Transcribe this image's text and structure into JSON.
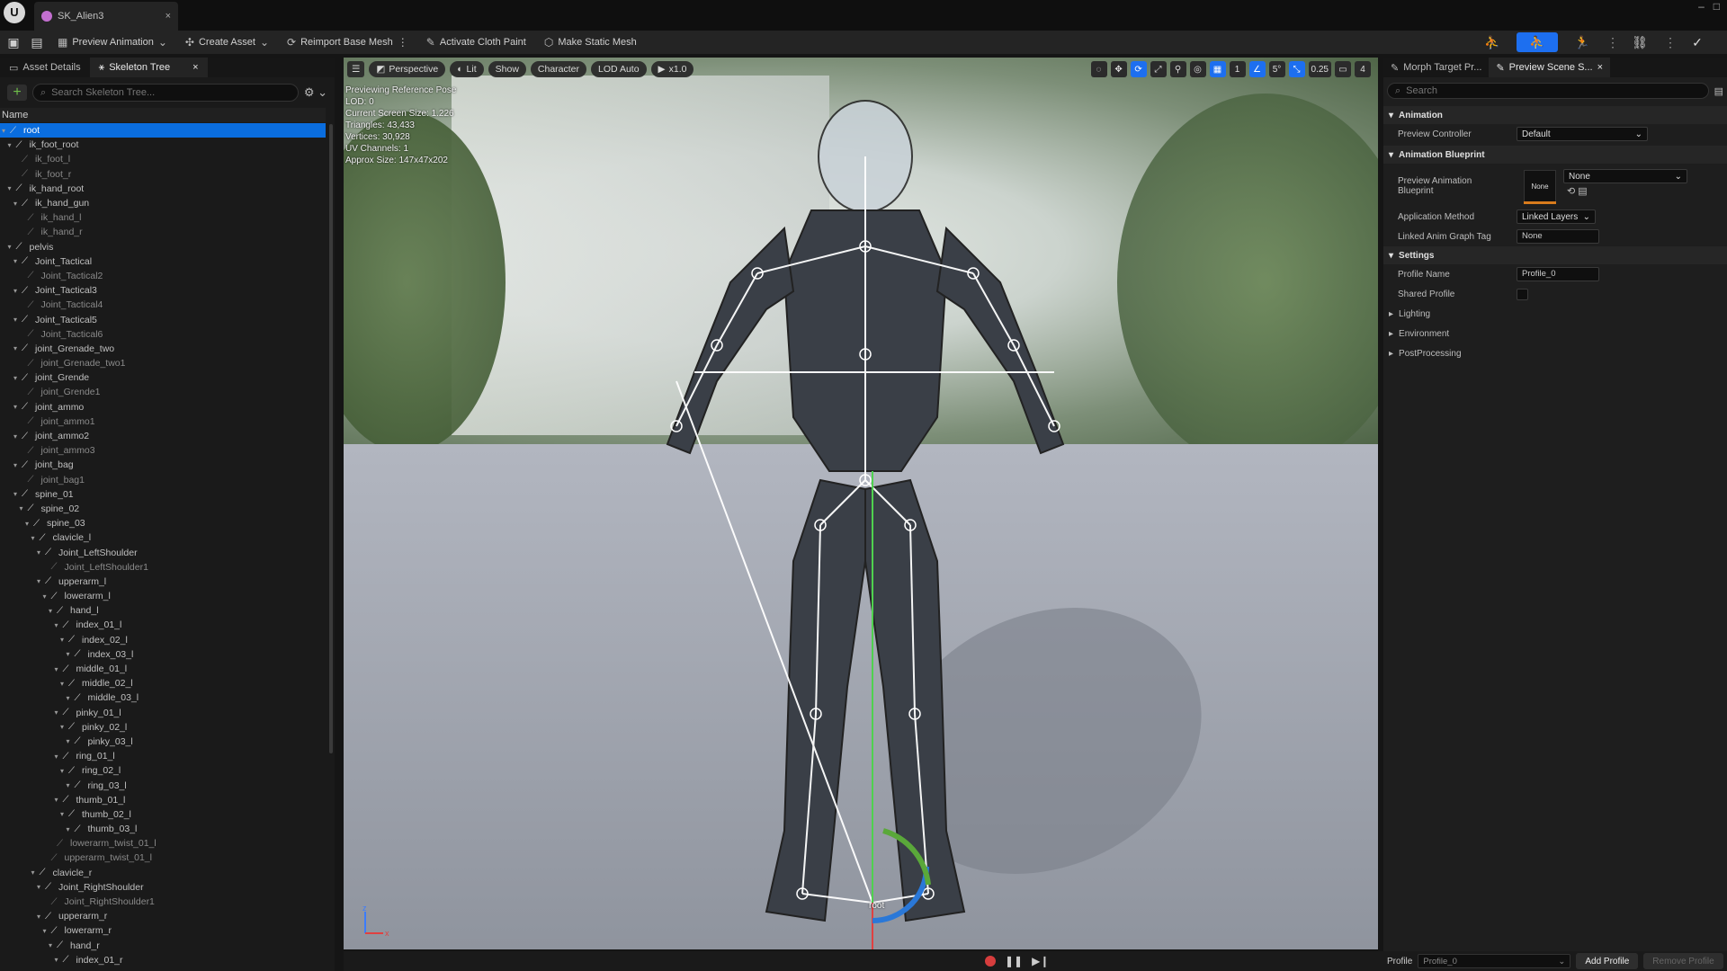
{
  "titlebar": {
    "tab_title": "SK_Alien3",
    "logo": "U"
  },
  "toolbar": {
    "buttons": [
      "Preview Animation",
      "Create Asset",
      "Reimport Base Mesh",
      "Activate Cloth Paint",
      "Make Static Mesh"
    ]
  },
  "left_panel": {
    "tabs": [
      "Asset Details",
      "Skeleton Tree"
    ],
    "search_placeholder": "Search Skeleton Tree...",
    "column_header": "Name",
    "bones": [
      {
        "name": "root",
        "depth": 0,
        "selected": true
      },
      {
        "name": "ik_foot_root",
        "depth": 1,
        "dim": false
      },
      {
        "name": "ik_foot_l",
        "depth": 2,
        "dim": true
      },
      {
        "name": "ik_foot_r",
        "depth": 2,
        "dim": true
      },
      {
        "name": "ik_hand_root",
        "depth": 1,
        "dim": false
      },
      {
        "name": "ik_hand_gun",
        "depth": 2,
        "dim": false
      },
      {
        "name": "ik_hand_l",
        "depth": 3,
        "dim": true
      },
      {
        "name": "ik_hand_r",
        "depth": 3,
        "dim": true
      },
      {
        "name": "pelvis",
        "depth": 1,
        "dim": false
      },
      {
        "name": "Joint_Tactical",
        "depth": 2,
        "dim": false
      },
      {
        "name": "Joint_Tactical2",
        "depth": 3,
        "dim": true
      },
      {
        "name": "Joint_Tactical3",
        "depth": 2,
        "dim": false
      },
      {
        "name": "Joint_Tactical4",
        "depth": 3,
        "dim": true
      },
      {
        "name": "Joint_Tactical5",
        "depth": 2,
        "dim": false
      },
      {
        "name": "Joint_Tactical6",
        "depth": 3,
        "dim": true
      },
      {
        "name": "joint_Grenade_two",
        "depth": 2,
        "dim": false
      },
      {
        "name": "joint_Grenade_two1",
        "depth": 3,
        "dim": true
      },
      {
        "name": "joint_Grende",
        "depth": 2,
        "dim": false
      },
      {
        "name": "joint_Grende1",
        "depth": 3,
        "dim": true
      },
      {
        "name": "joint_ammo",
        "depth": 2,
        "dim": false
      },
      {
        "name": "joint_ammo1",
        "depth": 3,
        "dim": true
      },
      {
        "name": "joint_ammo2",
        "depth": 2,
        "dim": false
      },
      {
        "name": "joint_ammo3",
        "depth": 3,
        "dim": true
      },
      {
        "name": "joint_bag",
        "depth": 2,
        "dim": false
      },
      {
        "name": "joint_bag1",
        "depth": 3,
        "dim": true
      },
      {
        "name": "spine_01",
        "depth": 2,
        "dim": false
      },
      {
        "name": "spine_02",
        "depth": 3,
        "dim": false
      },
      {
        "name": "spine_03",
        "depth": 4,
        "dim": false
      },
      {
        "name": "clavicle_l",
        "depth": 5,
        "dim": false
      },
      {
        "name": "Joint_LeftShoulder",
        "depth": 6,
        "dim": false
      },
      {
        "name": "Joint_LeftShoulder1",
        "depth": 7,
        "dim": true
      },
      {
        "name": "upperarm_l",
        "depth": 6,
        "dim": false
      },
      {
        "name": "lowerarm_l",
        "depth": 7,
        "dim": false
      },
      {
        "name": "hand_l",
        "depth": 8,
        "dim": false
      },
      {
        "name": "index_01_l",
        "depth": 9,
        "dim": false
      },
      {
        "name": "index_02_l",
        "depth": 10,
        "dim": false
      },
      {
        "name": "index_03_l",
        "depth": 11,
        "dim": false
      },
      {
        "name": "middle_01_l",
        "depth": 9,
        "dim": false
      },
      {
        "name": "middle_02_l",
        "depth": 10,
        "dim": false
      },
      {
        "name": "middle_03_l",
        "depth": 11,
        "dim": false
      },
      {
        "name": "pinky_01_l",
        "depth": 9,
        "dim": false
      },
      {
        "name": "pinky_02_l",
        "depth": 10,
        "dim": false
      },
      {
        "name": "pinky_03_l",
        "depth": 11,
        "dim": false
      },
      {
        "name": "ring_01_l",
        "depth": 9,
        "dim": false
      },
      {
        "name": "ring_02_l",
        "depth": 10,
        "dim": false
      },
      {
        "name": "ring_03_l",
        "depth": 11,
        "dim": false
      },
      {
        "name": "thumb_01_l",
        "depth": 9,
        "dim": false
      },
      {
        "name": "thumb_02_l",
        "depth": 10,
        "dim": false
      },
      {
        "name": "thumb_03_l",
        "depth": 11,
        "dim": false
      },
      {
        "name": "lowerarm_twist_01_l",
        "depth": 8,
        "dim": true
      },
      {
        "name": "upperarm_twist_01_l",
        "depth": 7,
        "dim": true
      },
      {
        "name": "clavicle_r",
        "depth": 5,
        "dim": false
      },
      {
        "name": "Joint_RightShoulder",
        "depth": 6,
        "dim": false
      },
      {
        "name": "Joint_RightShoulder1",
        "depth": 7,
        "dim": true
      },
      {
        "name": "upperarm_r",
        "depth": 6,
        "dim": false
      },
      {
        "name": "lowerarm_r",
        "depth": 7,
        "dim": false
      },
      {
        "name": "hand_r",
        "depth": 8,
        "dim": false
      },
      {
        "name": "index_01_r",
        "depth": 9,
        "dim": false
      }
    ]
  },
  "viewport": {
    "toolbar": [
      "Perspective",
      "Lit",
      "Show",
      "Character",
      "LOD Auto",
      "x1.0"
    ],
    "right_icons": [
      "1",
      "5°",
      "0.25",
      "4"
    ],
    "stats": [
      "Previewing Reference Pose",
      "LOD: 0",
      "Current Screen Size: 1.226",
      "Triangles: 43,433",
      "Vertices: 30,928",
      "UV Channels: 1",
      "Approx Size: 147x47x202"
    ],
    "root_label": "root",
    "axes": {
      "z": "z",
      "x": "x"
    }
  },
  "right_panel": {
    "tabs": [
      "Morph Target Pr...",
      "Preview Scene S..."
    ],
    "search_placeholder": "Search",
    "sections": {
      "animation": "Animation",
      "animation_blueprint": "Animation Blueprint",
      "settings": "Settings"
    },
    "props": {
      "preview_controller_label": "Preview Controller",
      "preview_controller_value": "Default",
      "preview_anim_bp_label": "Preview Animation Blueprint",
      "preview_anim_bp_thumb": "None",
      "preview_anim_bp_value": "None",
      "application_method_label": "Application Method",
      "application_method_value": "Linked Layers",
      "linked_anim_tag_label": "Linked Anim Graph Tag",
      "linked_anim_tag_value": "None",
      "profile_name_label": "Profile Name",
      "profile_name_value": "Profile_0",
      "shared_profile_label": "Shared Profile"
    },
    "subsections": [
      "Lighting",
      "Environment",
      "PostProcessing"
    ]
  },
  "bottom": {
    "profile_label": "Profile",
    "profile_value": "Profile_0",
    "add_profile": "Add Profile",
    "remove_profile": "Remove Profile"
  },
  "colors": {
    "accent": "#1d6ff0",
    "selection": "#0a6dde",
    "panel": "#1a1a1a"
  }
}
